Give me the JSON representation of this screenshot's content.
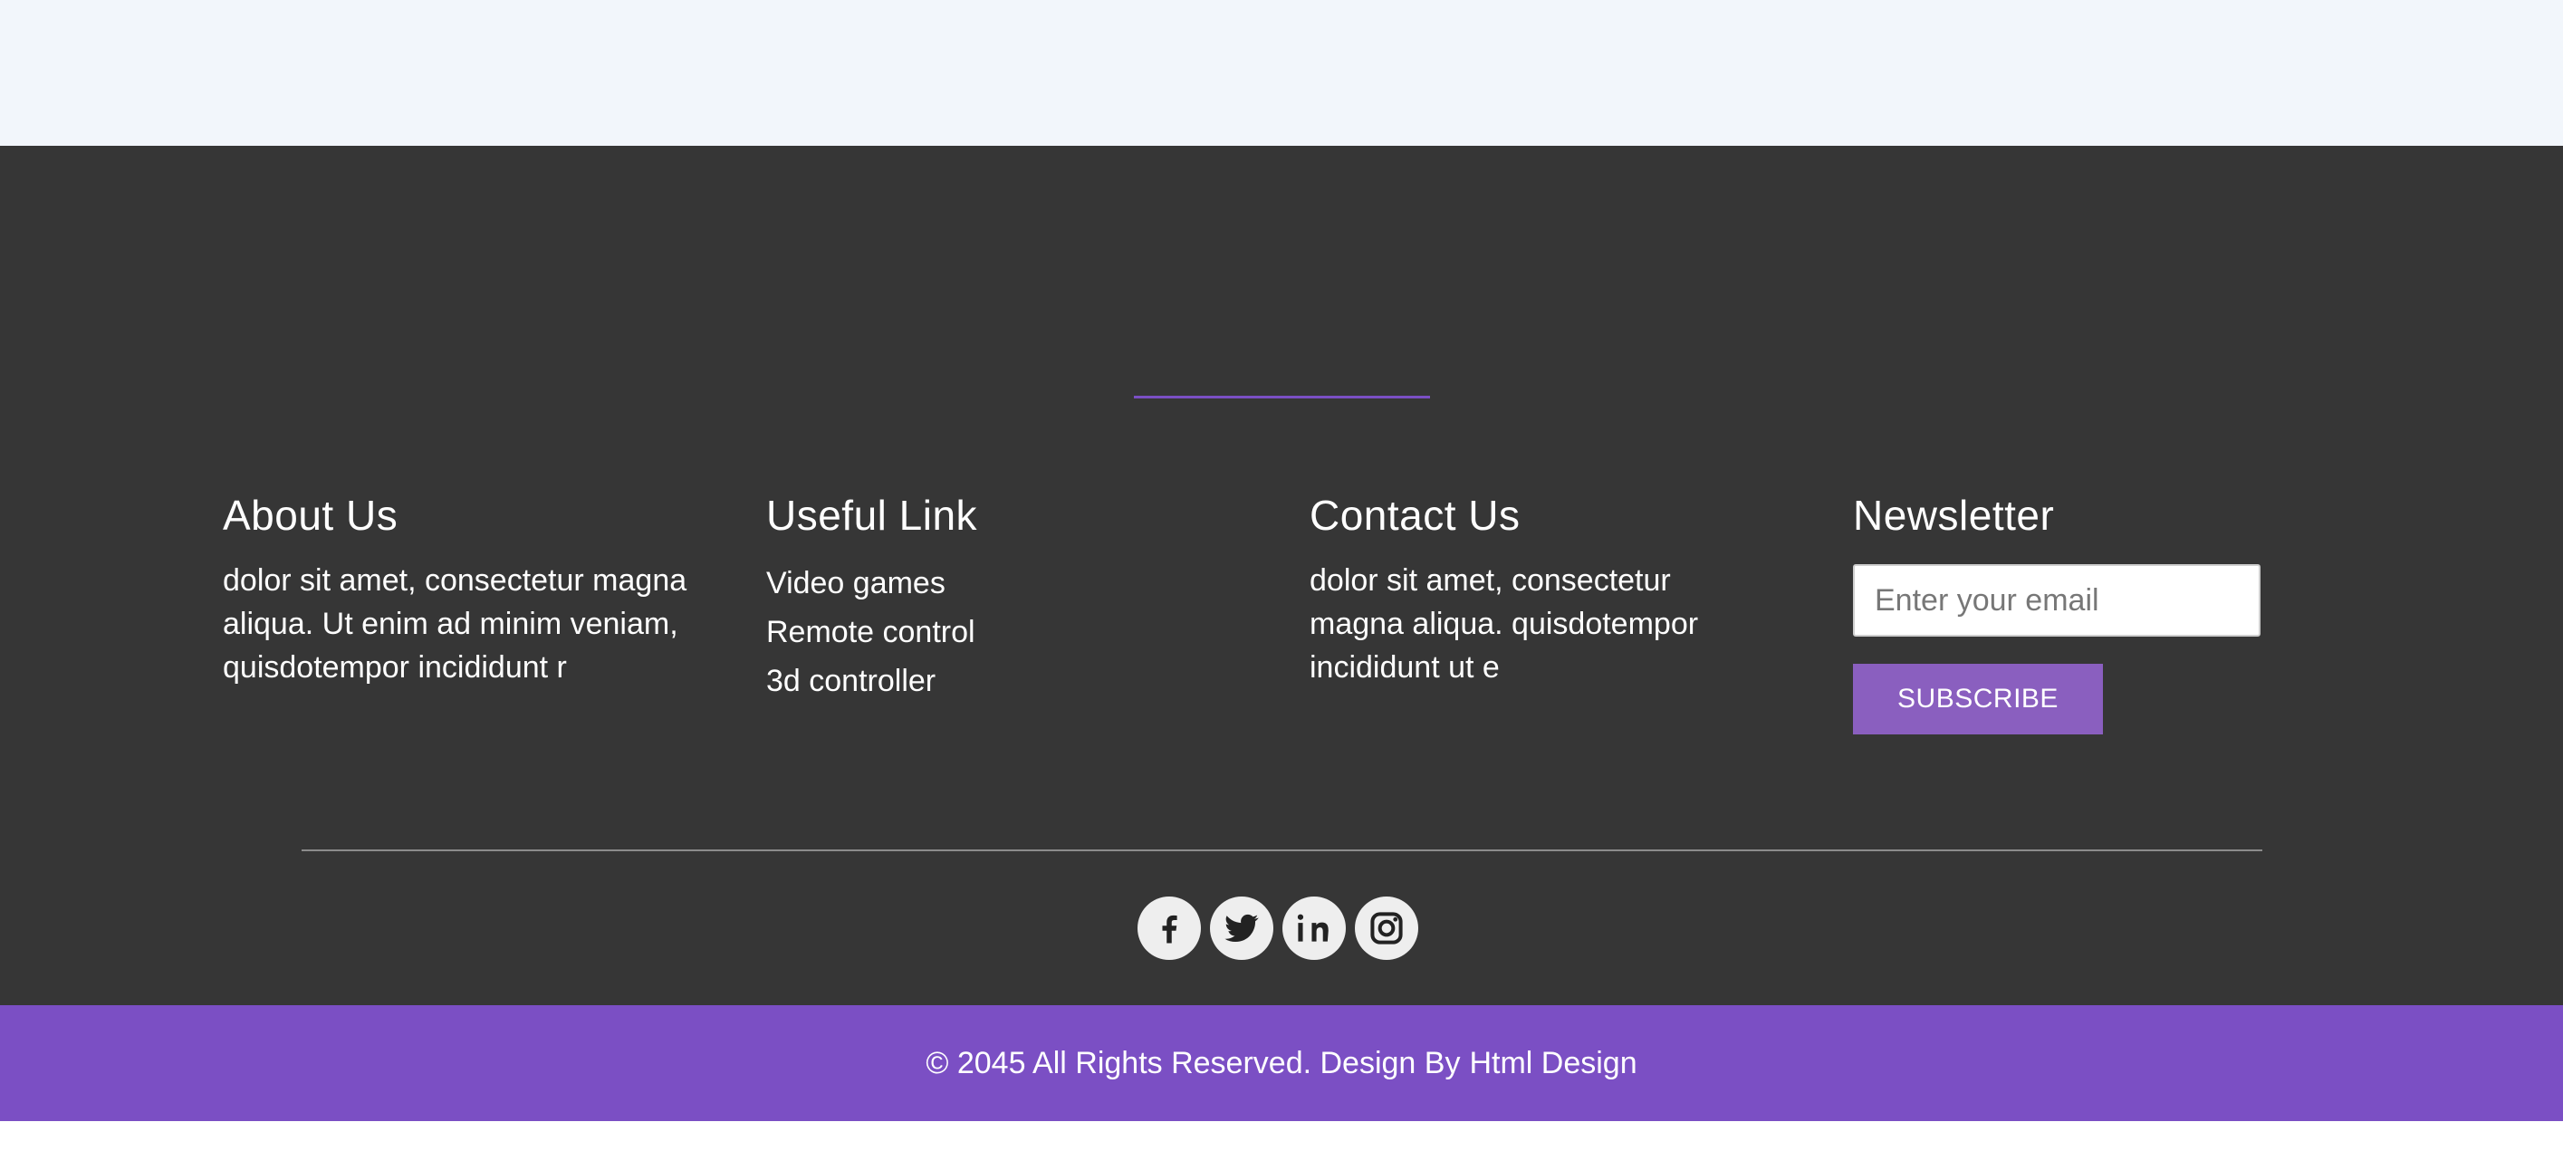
{
  "about": {
    "title": "About Us",
    "text": "dolor sit amet, consectetur magna aliqua. Ut enim ad minim veniam, quisdotempor incididunt r"
  },
  "useful": {
    "title": "Useful Link",
    "links": [
      "Video games",
      "Remote control",
      "3d controller"
    ]
  },
  "contact": {
    "title": "Contact Us",
    "text": "dolor sit amet, consectetur magna aliqua. quisdotempor incididunt ut e"
  },
  "newsletter": {
    "title": "Newsletter",
    "placeholder": "Enter your email",
    "button": "SUBSCRIBE"
  },
  "social": [
    "facebook-icon",
    "twitter-icon",
    "linkedin-icon",
    "instagram-icon"
  ],
  "copyright": {
    "text": "© 2045 All Rights Reserved. Design By",
    "link": "Html Design"
  },
  "colors": {
    "accent": "#7b4fc4",
    "button": "#8a5fbf",
    "footer_bg": "#363636",
    "top_bg": "#f2f6fb"
  }
}
